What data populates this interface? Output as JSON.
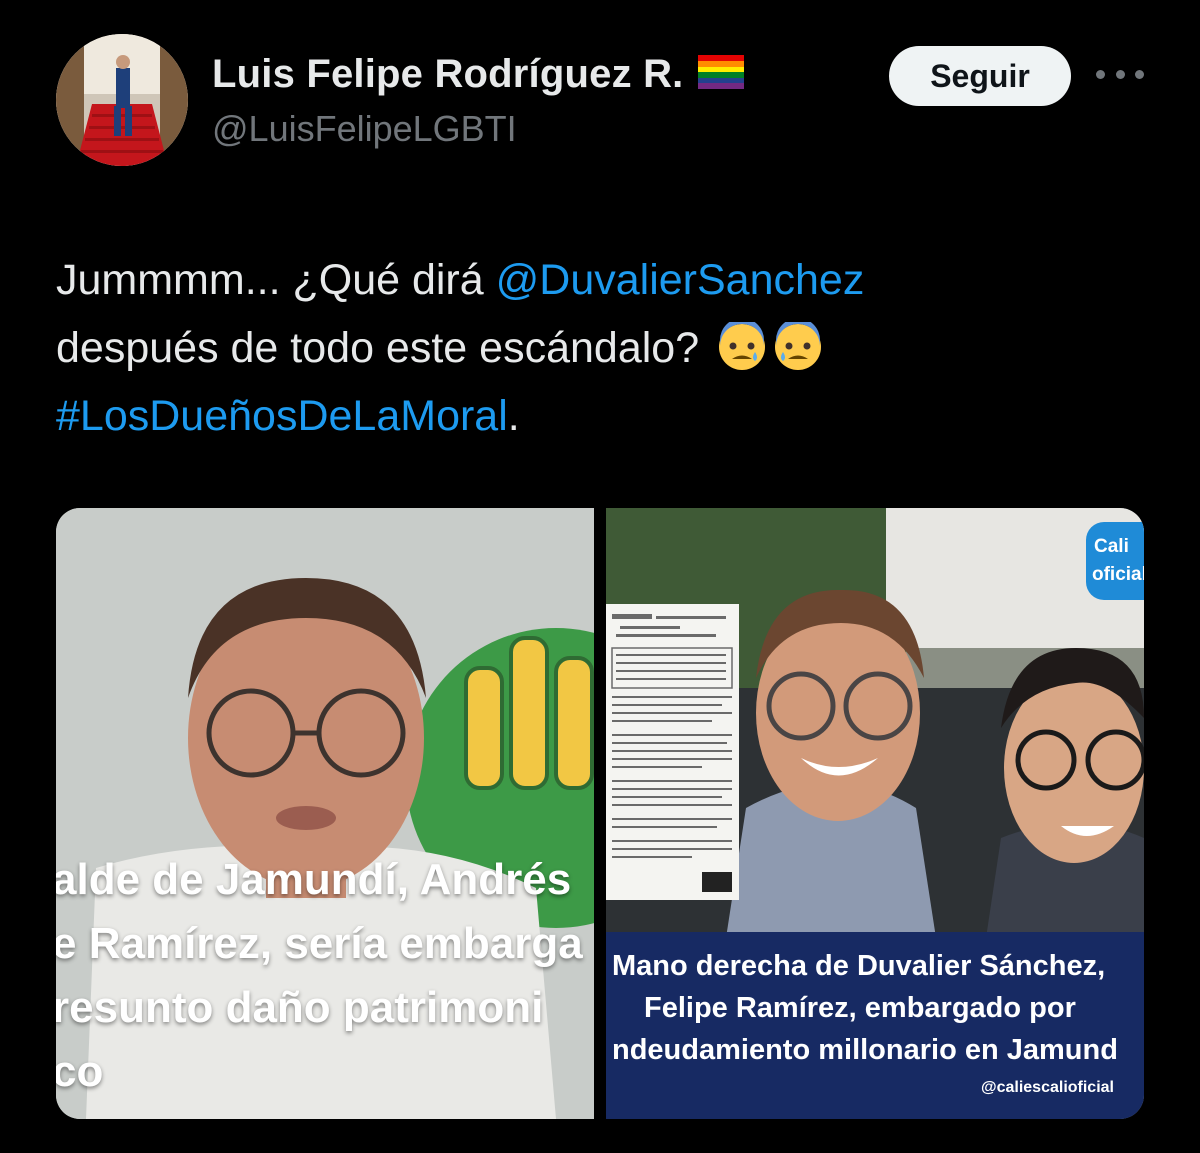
{
  "author": {
    "name": "Luis Felipe Rodríguez R.",
    "handle": "@LuisFelipeLGBTI"
  },
  "follow_label": "Seguir",
  "tweet": {
    "part1": "Jummmm... ¿Qué dirá ",
    "mention": "@DuvalierSanchez",
    "part2": " después de todo este escándalo?",
    "hashtag": "#LosDueñosDeLaMoral",
    "part3": "."
  },
  "media": {
    "left_caption": [
      "alde de Jamundí, Andrés",
      "e Ramírez, sería embarga",
      "resunto daño patrimoni",
      "co"
    ],
    "right_caption": [
      "Mano derecha de Duvalier Sánchez,",
      "Felipe Ramírez, embargado por",
      "ndeudamiento millonario en Jamund"
    ],
    "right_credit": "@caliescalioficial",
    "badge_line1": "Cali",
    "badge_line2": "oficial"
  },
  "icons": [
    "rainbow-flag-icon",
    "more-options-icon",
    "anxious-face-icon"
  ],
  "colors": {
    "background": "#000000",
    "link": "#1d9bf0",
    "secondary": "#71767b",
    "follow_bg": "#eff3f4"
  }
}
